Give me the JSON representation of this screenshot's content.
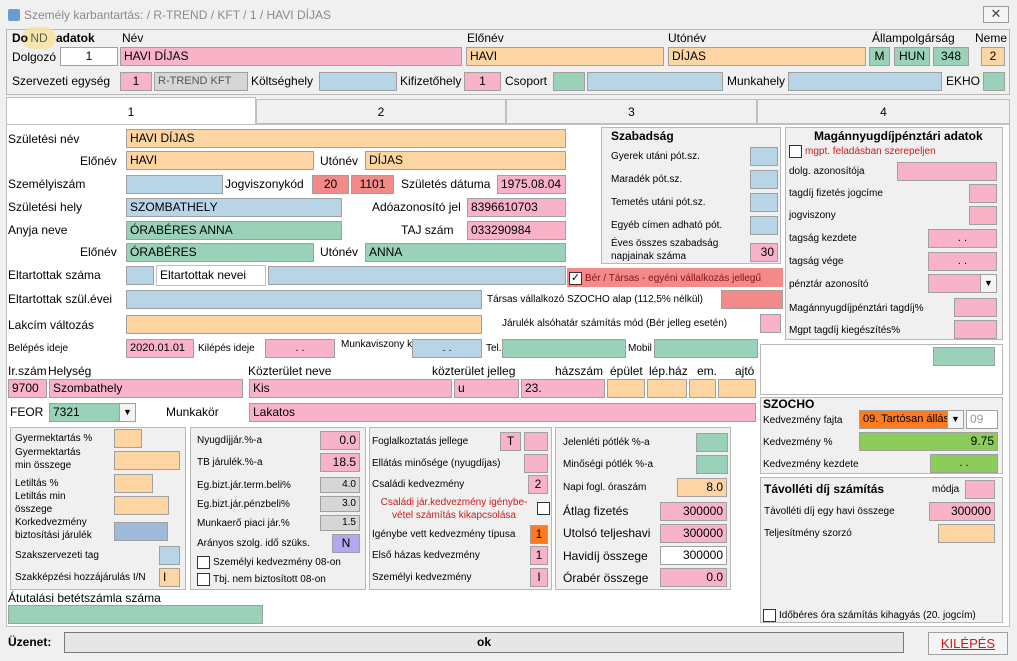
{
  "window": {
    "title": "Személy karbantartás: / R-TREND / KFT / 1 / HAVI DÍJAS"
  },
  "header": {
    "badge": "ND",
    "section_label": "Do",
    "section_label_rest": "adatok",
    "nev_label": "Név",
    "elonev_label": "Előnév",
    "utonev_label": "Utónév",
    "allampolgarsag_label": "Állampolgárság",
    "neme_label": "Neme",
    "dolgozo_label": "Dolgozó",
    "dolgozo_value": "1",
    "nev_value": "HAVI DÍJAS",
    "elonev_value": "HAVI",
    "utonev_value": "DÍJAS",
    "allampolgarsag_m": "M",
    "allampolgarsag_code": "HUN",
    "allampolgarsag_num": "348",
    "neme_value": "2",
    "szerv_label": "Szervezeti egység",
    "szerv_value": "1",
    "szerv_name": "R-TREND KFT",
    "koltseghely_label": "Költséghely",
    "kifizetohely_label": "Kifizetőhely",
    "kifizetohely_value": "1",
    "csoport_label": "Csoport",
    "munkahely_label": "Munkahely",
    "ekho_label": "EKHO"
  },
  "tabs": [
    "1",
    "2",
    "3",
    "4"
  ],
  "personal": {
    "szul_nev_label": "Születési név",
    "szul_nev": "HAVI DÍJAS",
    "elonev_label": "Előnév",
    "elonev": "HAVI",
    "utonev_label": "Utónév",
    "utonev": "DÍJAS",
    "szemelyiszam_label": "Személyiszám",
    "jogviszonykod_label": "Jogviszonykód",
    "jogviszonykod_1": "20",
    "jogviszonykod_2": "1101",
    "szul_datum_label": "Születés dátuma",
    "szul_datum": "1975.08.04",
    "szul_hely_label": "Születési hely",
    "szul_hely": "SZOMBATHELY",
    "adoazonosito_label": "Adóazonosító jel",
    "adoazonosito": "8396610703",
    "anyja_neve_label": "Anyja neve",
    "anyja_neve": "ÓRABÉRES ANNA",
    "taj_label": "TAJ szám",
    "taj": "033290984",
    "anyja_elonev_label": "Előnév",
    "anyja_elonev": "ÓRABÉRES",
    "anyja_utonev_label": "Utónév",
    "anyja_utonev": "ANNA",
    "eltartottak_szama_label": "Eltartottak száma",
    "eltartottak_nevei_label": "Eltartottak nevei",
    "ber_tarsas_label": "Bér / Társas - egyéni vállalkozás jellegű",
    "eltartottak_szul_label": "Eltartottak szül.évei",
    "tarsas_szocho_label": "Társas vállalkozó SZOCHO alap (112,5% nélkül)",
    "lakcim_label": "Lakcím változás",
    "jarulek_label": "Járulék alsóhatár számítás mód (Bér jelleg esetén)",
    "belepes_label": "Belépés ideje",
    "belepes": "2020.01.01",
    "kilepes_label": "Kilépés ideje",
    "kilepes": ". .",
    "munkaviszony_label": "Munkaviszony kezdete",
    "munkaviszony": ". .",
    "tel_label": "Tel.",
    "mobil_label": "Mobil"
  },
  "address": {
    "irszam_label": "Ir.szám",
    "helyseg_label": "Helység",
    "kozterulet_label": "Közterület neve",
    "jelleg_label": "közterület jelleg",
    "hazszam_label": "házszám",
    "epulet_label": "épület",
    "lephaz_label": "lép.ház",
    "em_label": "em.",
    "ajto_label": "ajtó",
    "irszam": "9700",
    "helyseg": "Szombathely",
    "kozterulet": "Kis",
    "jelleg": "u",
    "hazszam": "23.",
    "feor_label": "FEOR",
    "feor": "7321",
    "munkakor_label": "Munkakör",
    "munkakor": "Lakatos"
  },
  "szabadsag": {
    "title": "Szabadság",
    "items": [
      "Gyerek utáni pót.sz.",
      "Maradék pót.sz.",
      "Temetés utáni pót.sz.",
      "Egyéb címen adható pót."
    ],
    "eves_label_1": "Éves összes szabadság",
    "eves_label_2": "napjainak száma",
    "eves_value": "30"
  },
  "magannyugdij": {
    "title": "Magánnyugdíjpénztári adatok",
    "mgpt_label": "mgpt. feladásban szerepeljen",
    "dolg_azon": "dolg. azonosítója",
    "tagdij_jogcime": "tagdíj fizetés jogcíme",
    "jogviszony": "jogviszony",
    "tagsag_kezdete": "tagság kezdete",
    "tagsag_kezdete_value": ". .",
    "tagsag_vege": "tagság vége",
    "tagsag_vege_value": ". .",
    "penztar_azon": "pénztár azonosító",
    "tagdij_pct": "Magánnyugdíjpénztári tagdíj%",
    "mgpt_kieg": "Mgpt tagdíj kiegészítés%"
  },
  "szocho": {
    "title": "SZOCHO",
    "kedv_fajta_label": "Kedvezmény fajta",
    "kedv_fajta_value": "09. Tartósan állás",
    "kedv_fajta_code": "09",
    "kedv_pct_label": "Kedvezmény %",
    "kedv_pct": "9.75",
    "kedv_kezdete_label": "Kedvezmény kezdete",
    "kedv_kezdete": ". ."
  },
  "tavolleti": {
    "title": "Távolléti díj számítás",
    "modja_label": "módja",
    "osszeg_label": "Távolléti díj egy havi összege",
    "osszeg": "300000",
    "szorzo_label": "Teljesítmény szorzó",
    "idoberes_label": "Időbéres óra számítás kihagyás (20. jogcím)"
  },
  "col1": {
    "gyermektartas_pct": "Gyermektartás %",
    "gyermektartas_min_1": "Gyermektartás",
    "gyermektartas_min_2": "min összege",
    "letiltas_pct": "Letiltás %",
    "letiltas_min_1": "Letiltás min",
    "letiltas_min_2": "összege",
    "korkedv_1": "Korkedvezmény",
    "korkedv_2": "biztosítási járulék",
    "szakszervezet": "Szakszervezeti tag",
    "szakkepzesi": "Szakképzési hozzájárulás I/N",
    "szakkepzesi_value": "I"
  },
  "col2": {
    "nyugdij_label": "Nyugdíjjár.%-a",
    "nyugdij": "0.0",
    "tb_label": "TB járulék.%-a",
    "tb": "18.5",
    "eg_term_label": "Eg.bizt.jár.term.beli%",
    "eg_term": "4.0",
    "eg_penz_label": "Eg.bizt.jár.pénzbeli%",
    "eg_penz": "3.0",
    "munkaero_label": "Munkaerő piaci jár.%",
    "munkaero": "1.5",
    "aranyos_label": "Arányos szolg. idő szüks.",
    "aranyos": "N",
    "szemelyi_kedv_label": "Személyi kedvezmény 08-on",
    "tbj_label": "Tbj. nem biztosított 08-on"
  },
  "col3": {
    "foglalkoztatas_label": "Foglalkoztatás jellege",
    "foglalkoztatas": "T",
    "ellatas_label": "Ellátás minősége (nyugdíjas)",
    "csaladi_label": "Családi kedvezmény",
    "csaladi": "2",
    "csaladi_jar_1": "Családi jár.kedvezmény igénybe-",
    "csaladi_jar_2": "vétel számítás kikapcsolása",
    "igenybe_label": "Igénybe vett kedvezmény típusa",
    "igenybe": "1",
    "elso_hazas_label": "Első házas kedvezmény",
    "elso_hazas": "1",
    "szemelyi_label": "Személyi kedvezmény",
    "szemelyi": "I"
  },
  "col4": {
    "jelenleti_label": "Jelenléti pótlék %-a",
    "minosegi_label": "Minőségi pótlék %-a",
    "napi_label": "Napi fogl. óraszám",
    "napi": "8.0",
    "atlag_label": "Átlag fizetés",
    "atlag": "300000",
    "utolso_label": "Utolsó teljeshavi",
    "utolso": "300000",
    "havidij_label": "Havidíj összege",
    "havidij": "300000",
    "oraber_label": "Órabér összege",
    "oraber": "0.0"
  },
  "bank": {
    "label": "Átutalási betétszámla száma"
  },
  "footer": {
    "uzenet_label": "Üzenet:",
    "uzenet": "ok",
    "kilepes": "KILÉPÉS"
  }
}
